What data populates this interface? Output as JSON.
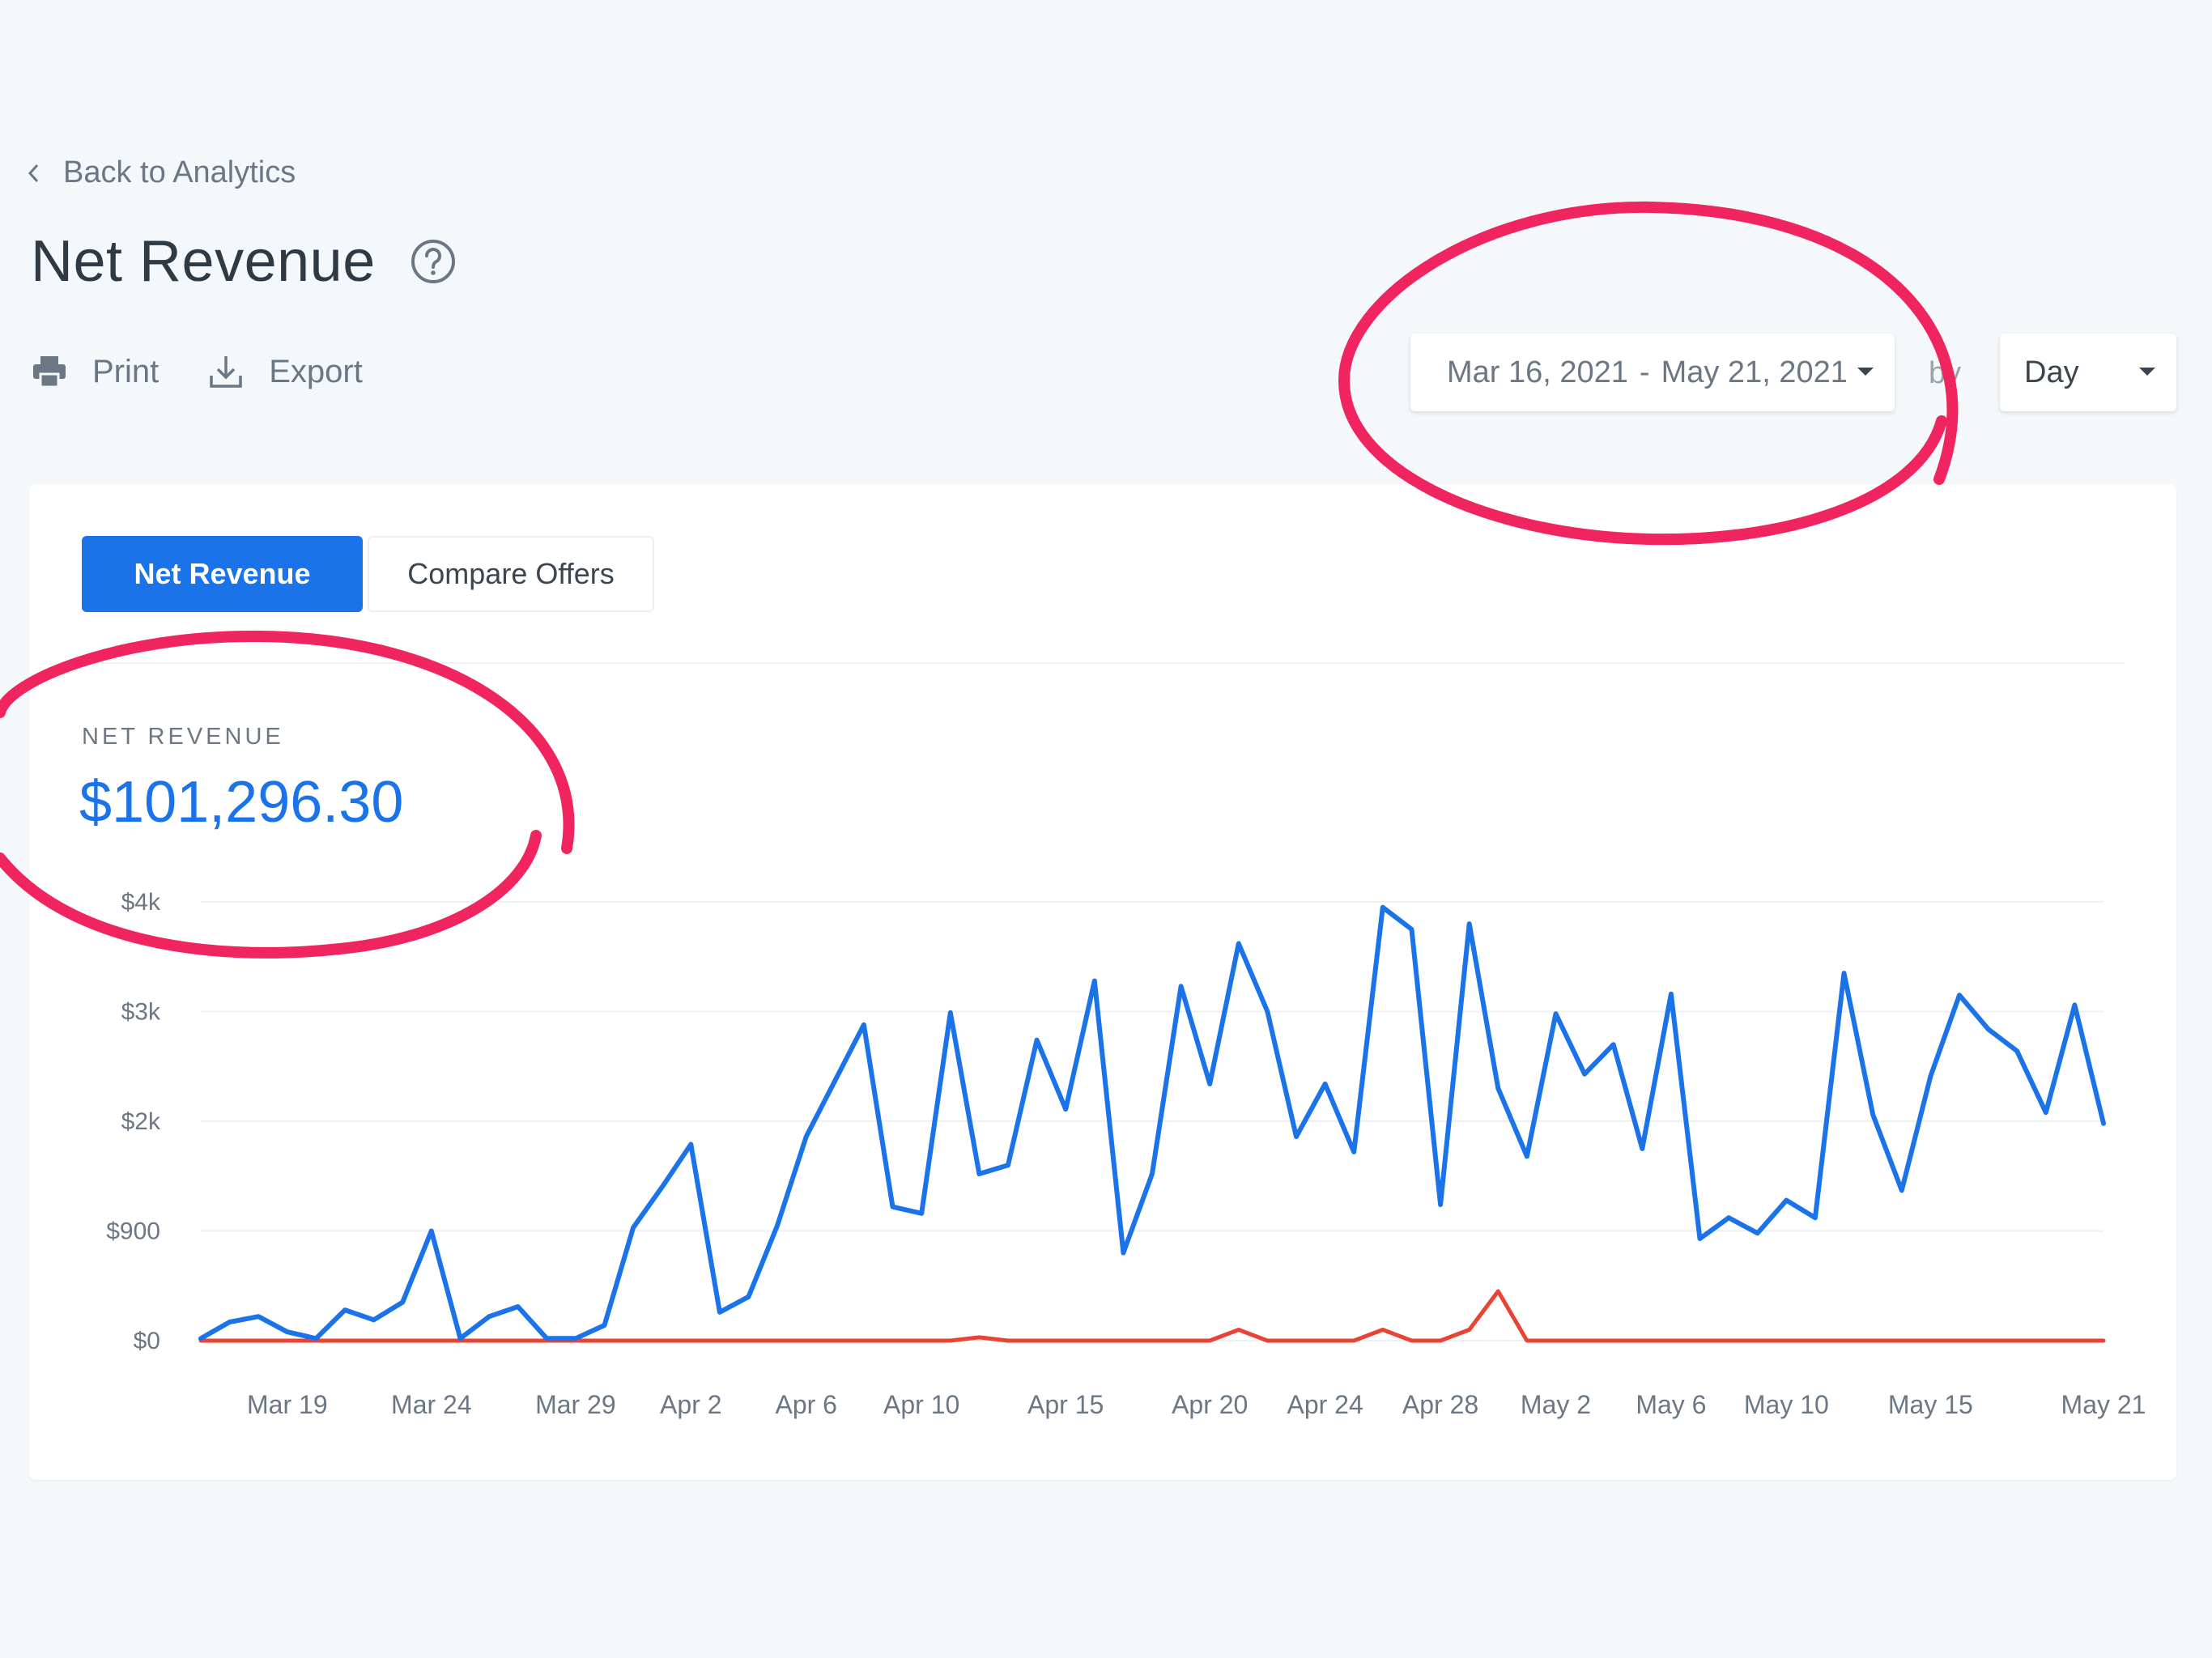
{
  "nav": {
    "back_label": "Back to Analytics"
  },
  "page": {
    "title": "Net Revenue"
  },
  "toolbar": {
    "print_label": "Print",
    "export_label": "Export"
  },
  "filters": {
    "start_date": "Mar 16, 2021",
    "separator": "-",
    "end_date": "May 21, 2021",
    "by_label": "by",
    "granularity": "Day"
  },
  "tabs": [
    {
      "label": "Net Revenue",
      "active": true
    },
    {
      "label": "Compare Offers",
      "active": false
    }
  ],
  "metric": {
    "label": "NET REVENUE",
    "value": "$101,296.30"
  },
  "colors": {
    "accent": "#1a73e8",
    "series_secondary": "#ea4335",
    "annotation": "#f0245e"
  },
  "chart_data": {
    "type": "line",
    "title": "",
    "xlabel": "",
    "ylabel": "",
    "y_ticks": [
      {
        "value": 0,
        "label": "$0"
      },
      {
        "value": 1,
        "label": "$900"
      },
      {
        "value": 2,
        "label": "$2k"
      },
      {
        "value": 3,
        "label": "$3k"
      },
      {
        "value": 4,
        "label": "$4k"
      }
    ],
    "ylim": [
      0,
      4
    ],
    "x_ticks": [
      "Mar 19",
      "Mar 24",
      "Mar 29",
      "Apr 2",
      "Apr 6",
      "Apr 10",
      "Apr 15",
      "Apr 20",
      "Apr 24",
      "Apr 28",
      "May 2",
      "May 6",
      "May 10",
      "May 15",
      "May 21"
    ],
    "x_tick_index": [
      3,
      8,
      13,
      17,
      21,
      25,
      30,
      35,
      39,
      43,
      47,
      51,
      55,
      60,
      66
    ],
    "series": [
      {
        "values": [
          0.02,
          0.17,
          0.22,
          0.08,
          0.02,
          0.28,
          0.19,
          0.35,
          1.0,
          0.02,
          0.22,
          0.31,
          0.02,
          0.02,
          0.14,
          1.03,
          1.4,
          1.79,
          0.26,
          0.4,
          1.05,
          1.86,
          2.37,
          2.88,
          1.22,
          1.16,
          2.99,
          1.52,
          1.6,
          2.74,
          2.11,
          3.28,
          0.8,
          1.52,
          3.23,
          2.34,
          3.62,
          3.0,
          1.86,
          2.34,
          1.72,
          3.95,
          3.75,
          1.24,
          3.8,
          2.3,
          1.68,
          2.98,
          2.43,
          2.7,
          1.75,
          3.16,
          0.93,
          1.12,
          0.98,
          1.28,
          1.12,
          3.35,
          2.06,
          1.37,
          2.41,
          3.15,
          2.84,
          2.64,
          2.08,
          3.06,
          1.98
        ]
      },
      {
        "values": [
          0,
          0,
          0,
          0,
          0,
          0,
          0,
          0,
          0,
          0,
          0,
          0,
          0,
          0,
          0,
          0,
          0,
          0,
          0,
          0,
          0,
          0,
          0,
          0,
          0,
          0,
          0,
          0.03,
          0,
          0,
          0,
          0,
          0,
          0,
          0,
          0,
          0.1,
          0,
          0,
          0,
          0,
          0.1,
          0,
          0,
          0.1,
          0.45,
          0,
          0,
          0,
          0,
          0,
          0,
          0,
          0,
          0,
          0,
          0,
          0,
          0,
          0,
          0,
          0,
          0,
          0,
          0,
          0,
          0
        ]
      }
    ]
  }
}
